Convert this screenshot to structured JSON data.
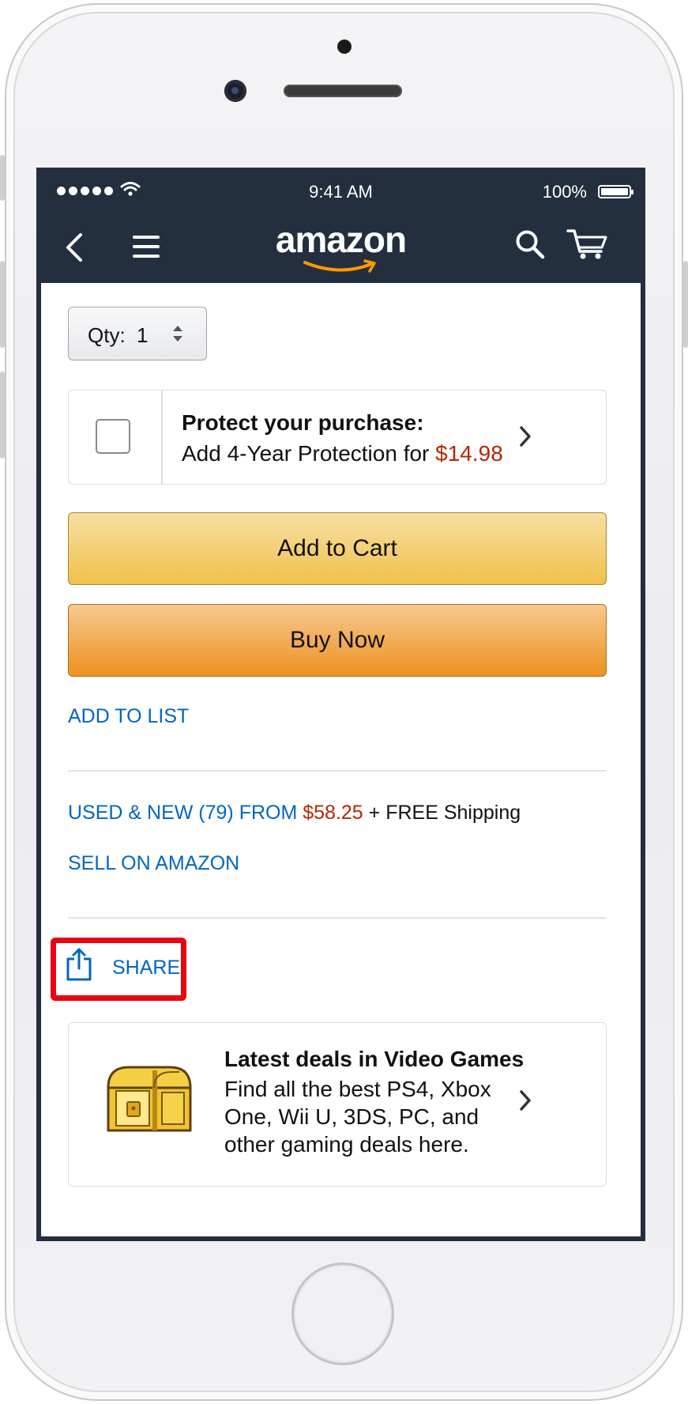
{
  "status_bar": {
    "time": "9:41 AM",
    "battery_percent": "100%"
  },
  "nav": {
    "logo_text": "amazon",
    "icons": [
      "back-arrow-icon",
      "hamburger-menu-icon",
      "search-icon",
      "cart-icon"
    ]
  },
  "quantity": {
    "label": "Qty:",
    "value": "1"
  },
  "protection": {
    "title": "Protect your purchase:",
    "text": "Add 4-Year Protection for ",
    "price": "$14.98",
    "checked": false
  },
  "buttons": {
    "add_to_cart": "Add to Cart",
    "buy_now": "Buy Now"
  },
  "links": {
    "add_to_list": "ADD TO LIST",
    "used_new": "USED & NEW (79) FROM ",
    "used_new_price": "$58.25",
    "shipping": " + FREE Shipping",
    "sell_on_amazon": "SELL ON AMAZON",
    "share": "SHARE"
  },
  "deals_card": {
    "title": "Latest deals in Video Games",
    "text": "Find all the best PS4, Xbox One, Wii U, 3DS, PC, and other gaming deals here.",
    "icon": "treasure-chest-icon"
  },
  "colors": {
    "nav_background": "#232f3e",
    "link_blue": "#0066c0",
    "price_red": "#b12704",
    "add_to_cart_yellow": "#f0c14b",
    "buy_now_orange": "#ed9220",
    "highlight_red": "#e8070f"
  }
}
